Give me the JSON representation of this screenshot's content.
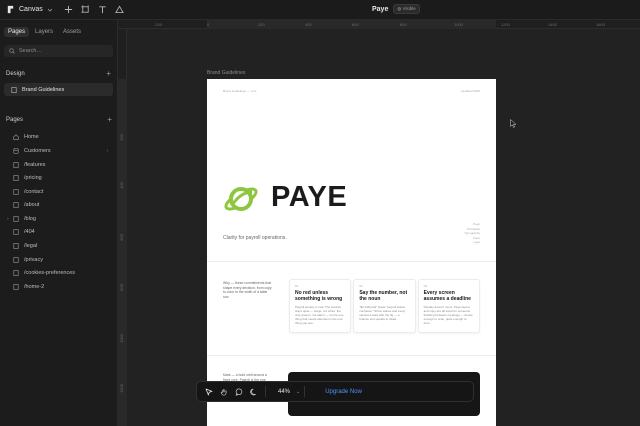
{
  "app": {
    "name": "Canvas",
    "project": "Paye",
    "project_badge": "Visible"
  },
  "sidebar": {
    "tabs": [
      {
        "label": "Pages"
      },
      {
        "label": "Layers"
      },
      {
        "label": "Assets"
      }
    ],
    "search_placeholder": "Search…",
    "design": {
      "heading": "Design",
      "items": [
        {
          "label": "Brand Guidelines"
        }
      ]
    },
    "pages": {
      "heading": "Pages",
      "items": [
        {
          "label": "Home"
        },
        {
          "label": "Customers"
        },
        {
          "label": "/features"
        },
        {
          "label": "/pricing"
        },
        {
          "label": "/contact"
        },
        {
          "label": "/about"
        },
        {
          "label": "/blog"
        },
        {
          "label": "/404"
        },
        {
          "label": "/legal"
        },
        {
          "label": "/privacy"
        },
        {
          "label": "/cookies-preferences"
        },
        {
          "label": "/home-2"
        }
      ]
    }
  },
  "canvas": {
    "frame_label": "Brand Guidelines",
    "ruler_top": [
      "-200",
      "0",
      "200",
      "400",
      "600",
      "800",
      "1000",
      "1200",
      "1400",
      "1600"
    ],
    "ruler_left": [
      "200",
      "400",
      "600",
      "800",
      "1000",
      "1200"
    ],
    "frame": {
      "top_left": "Brand Guidelines — v1.0",
      "top_right": "Updated 2026",
      "brand_word": "PAYE",
      "tagline": "Clarity for payroll operations.",
      "side_notes": [
        "Paye",
        "Principles",
        "Typography",
        "Color",
        "Logo"
      ],
      "section_note_1": "Why — these commitments that shape every decision, from copy to color to the width of a table row.",
      "cards": [
        {
          "num": "01",
          "title": "No red unless something is wrong",
          "body": "Payroll anxiety is real. The product stays quiet — beige, not white; the only greens, not alarm — so the one thing that needs attention is the one thing you see."
        },
        {
          "num": "02",
          "title": "Say the number, not the noun",
          "body": "\"$2,148 paid\" beats \"payroll status complete.\" Show values and every sentence lead with the fig — a finance tool speaks in totals."
        },
        {
          "num": "03",
          "title": "Every screen assumes a deadline",
          "body": "Payday doesn't move. Paye layout and copy are all sized for someone finishing between meetings — dense enough to scan, quiet enough to trust."
        }
      ],
      "section_note_2": "Mark — a bold orbit around a fixed core. Payroll is the one thing that keeps moving around an axis. One color applied on the ring, never the wordmark."
    }
  },
  "toolbar": {
    "zoom": "44%",
    "upgrade_label": "Upgrade Now"
  },
  "colors": {
    "brand_green": "#8dc63f",
    "accent_blue": "#4e93ff",
    "canvas_bg": "#222222"
  }
}
